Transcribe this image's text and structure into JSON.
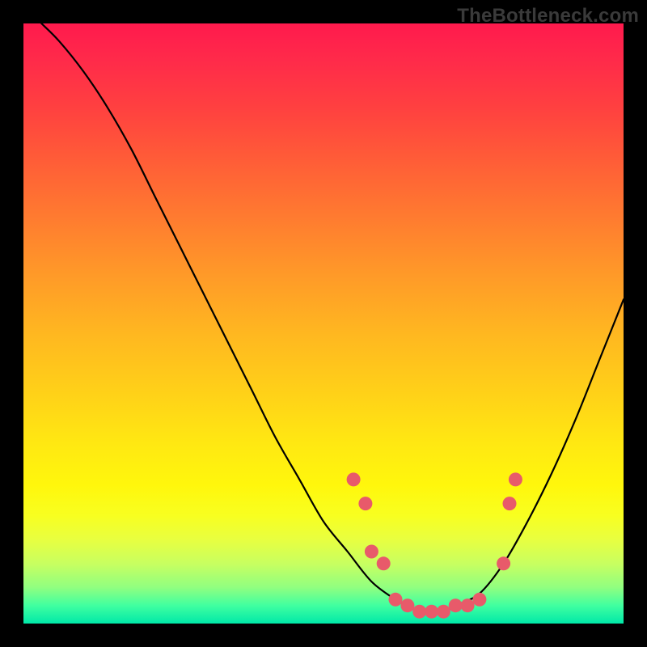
{
  "watermark": "TheBottleneck.com",
  "chart_data": {
    "type": "line",
    "title": "",
    "xlabel": "",
    "ylabel": "",
    "xlim": [
      0,
      100
    ],
    "ylim": [
      0,
      100
    ],
    "grid": false,
    "legend": false,
    "background": "red-yellow-green vertical gradient",
    "series": [
      {
        "name": "curve",
        "x": [
          3,
          6,
          10,
          14,
          18,
          22,
          26,
          30,
          34,
          38,
          42,
          46,
          50,
          54,
          58,
          62,
          64,
          66,
          68,
          70,
          72,
          76,
          80,
          84,
          88,
          92,
          96,
          100
        ],
        "y": [
          100,
          97,
          92,
          86,
          79,
          71,
          63,
          55,
          47,
          39,
          31,
          24,
          17,
          12,
          7,
          4,
          3,
          2,
          2,
          2,
          3,
          5,
          10,
          17,
          25,
          34,
          44,
          54
        ]
      }
    ],
    "markers": {
      "name": "highlight-dots",
      "color": "#e85a6a",
      "x": [
        55,
        57,
        58,
        60,
        62,
        64,
        66,
        68,
        70,
        72,
        74,
        76,
        80,
        81,
        82
      ],
      "y": [
        24,
        20,
        12,
        10,
        4,
        3,
        2,
        2,
        2,
        3,
        3,
        4,
        10,
        20,
        24
      ]
    }
  }
}
